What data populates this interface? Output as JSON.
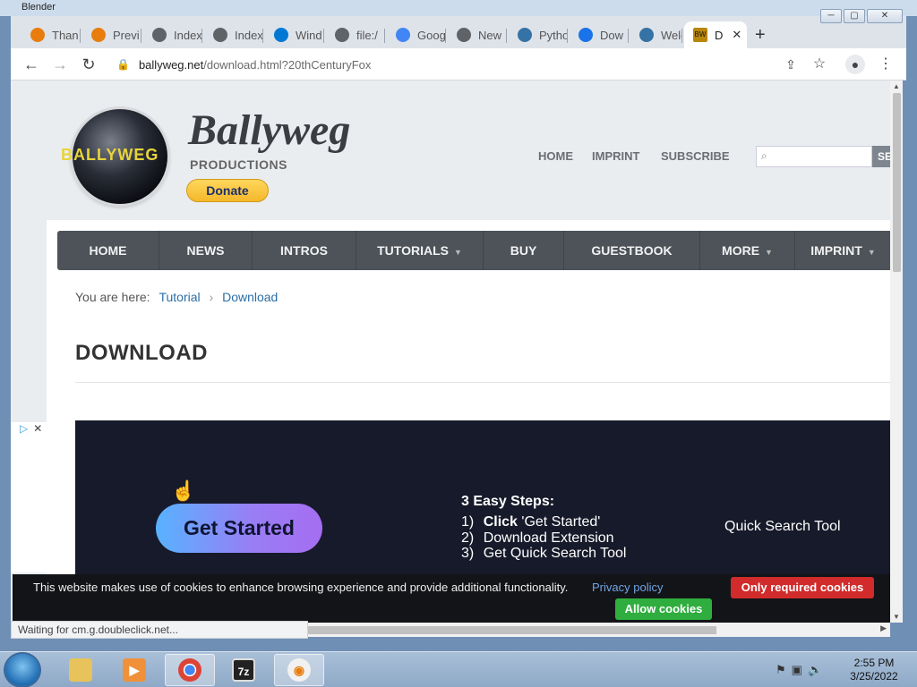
{
  "window": {
    "title": "Blender"
  },
  "tabs": [
    {
      "label": "Than",
      "icon": "blender-icon",
      "color": "#e87d0d"
    },
    {
      "label": "Previ",
      "icon": "blender-icon",
      "color": "#e87d0d"
    },
    {
      "label": "Index",
      "icon": "globe-icon",
      "color": "#5f6368"
    },
    {
      "label": "Index",
      "icon": "globe-icon",
      "color": "#5f6368"
    },
    {
      "label": "Wind",
      "icon": "windows-icon",
      "color": "#0078d4"
    },
    {
      "label": "file:/",
      "icon": "globe-icon",
      "color": "#5f6368"
    },
    {
      "label": "Goog",
      "icon": "google-icon",
      "color": "#4285f4"
    },
    {
      "label": "New",
      "icon": "chrome-icon",
      "color": "#5f6368"
    },
    {
      "label": "Pytho",
      "icon": "python-icon",
      "color": "#3572a5"
    },
    {
      "label": "Dow",
      "icon": "download-icon",
      "color": "#1a73e8"
    },
    {
      "label": "Welc",
      "icon": "python-icon",
      "color": "#3572a5"
    },
    {
      "label": "D",
      "icon": "bw-favicon-icon",
      "color": "#b8860b",
      "active": true
    }
  ],
  "address": {
    "host": "ballyweg.net",
    "rest": "/download.html?20thCenturyFox"
  },
  "site": {
    "logo_text": "BALLYWEG",
    "brand": "Ballyweg",
    "subtitle": "PRODUCTIONS",
    "donate": "Donate",
    "top_links": [
      "HOME",
      "IMPRINT",
      "SUBSCRIBE"
    ],
    "search_button": "SE",
    "nav": [
      {
        "label": "HOME",
        "dropdown": false
      },
      {
        "label": "NEWS",
        "dropdown": false
      },
      {
        "label": "INTROS",
        "dropdown": false
      },
      {
        "label": "TUTORIALS",
        "dropdown": true
      },
      {
        "label": "BUY",
        "dropdown": false
      },
      {
        "label": "GUESTBOOK",
        "dropdown": false
      },
      {
        "label": "MORE",
        "dropdown": true
      },
      {
        "label": "IMPRINT",
        "dropdown": true
      }
    ],
    "breadcrumb": {
      "prefix": "You are here:",
      "items": [
        "Tutorial",
        "Download"
      ]
    },
    "page_title": "DOWNLOAD"
  },
  "ad": {
    "cta": "Get Started",
    "steps_title": "3 Easy Steps:",
    "steps": [
      {
        "num": "1)",
        "bold": "Click",
        "text": " 'Get Started'"
      },
      {
        "num": "2)",
        "bold": "",
        "text": "Download Extension"
      },
      {
        "num": "3)",
        "bold": "",
        "text": "Get Quick Search Tool"
      }
    ],
    "product": "Quick Search Tool"
  },
  "cookie": {
    "message": "This website makes use of cookies to enhance browsing experience and provide additional functionality.",
    "privacy_link": "Privacy policy",
    "required_button": "Only required cookies",
    "allow_button": "Allow cookies"
  },
  "status": "Waiting for cm.g.doubleclick.net...",
  "taskbar": {
    "clock_time": "2:55 PM",
    "clock_date": "3/25/2022"
  }
}
